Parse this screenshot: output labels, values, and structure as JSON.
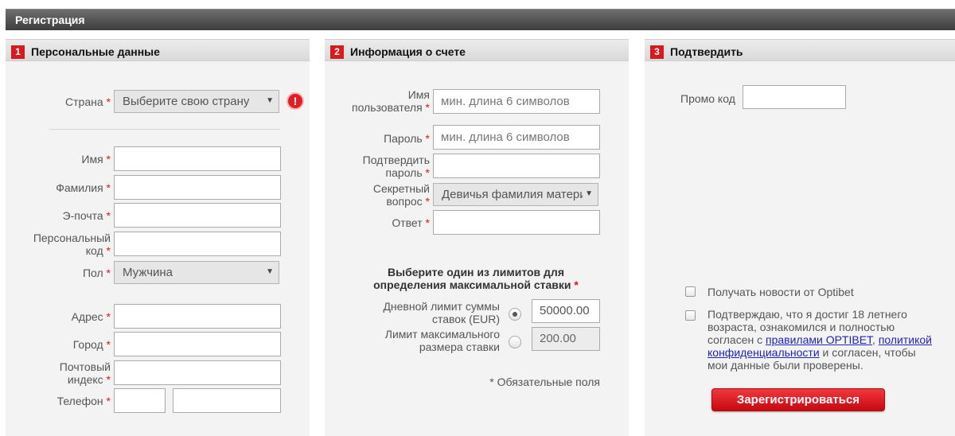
{
  "header": {
    "title": "Регистрация"
  },
  "personal": {
    "number": "1",
    "title": "Персональные данные",
    "country_label": "Страна",
    "country_select": "Выберите свою страну",
    "error_icon": "!",
    "first_name_label": "Имя",
    "last_name_label": "Фамилия",
    "email_label": "Э-почта",
    "personal_code_label_1": "Персональный",
    "personal_code_label_2": "код",
    "gender_label": "Пол",
    "gender_select": "Мужчина",
    "address_label": "Адрес",
    "city_label": "Город",
    "postal_label_1": "Почтовый",
    "postal_label_2": "индекс",
    "phone_label": "Телефон"
  },
  "account": {
    "number": "2",
    "title": "Информация о счете",
    "username_label_1": "Имя",
    "username_label_2": "пользователя",
    "username_placeholder": "мин. длина 6 символов",
    "password_label": "Пароль",
    "password_placeholder": "мин. длина 6 символов",
    "confirm_label_1": "Подтвердить",
    "confirm_label_2": "пароль",
    "secret_label_1": "Секретный",
    "secret_label_2": "вопрос",
    "secret_select": "Девичья фамилия матери",
    "answer_label": "Ответ",
    "limits_heading_1": "Выберите один из лимитов для",
    "limits_heading_2": "определения максимальной ставки",
    "daily_label_1": "Дневной лимит суммы",
    "daily_label_2": "ставок (EUR)",
    "daily_value": "50000.00",
    "max_label_1": "Лимит максимального",
    "max_label_2": "размера ставки",
    "max_value": "200.00",
    "required_note": "* Обязательные поля"
  },
  "confirm": {
    "number": "3",
    "title": "Подтвердить",
    "promo_label": "Промо код",
    "news_label": "Получать новости от Optibet",
    "terms_1": "Подтверждаю, что я достиг 18 летнего",
    "terms_2": "возраста, ознакомился и полностью",
    "terms_3": "согласен с ",
    "terms_link1": "правилами OPTIBET",
    "terms_comma": ", ",
    "terms_link2a": "политикой",
    "terms_link2b": "конфиденциальности",
    "terms_4": " и согласен, чтобы",
    "terms_5": "мои данные были проверены.",
    "register_button": "Зарегистрироваться"
  },
  "colors": {
    "accent": "#d71920",
    "header_bar": "#4a4a4a",
    "panel_bg": "#f3f3f3"
  },
  "icons": {
    "error": "exclamation-circle-icon",
    "dropdown": "triangle-down-icon"
  }
}
